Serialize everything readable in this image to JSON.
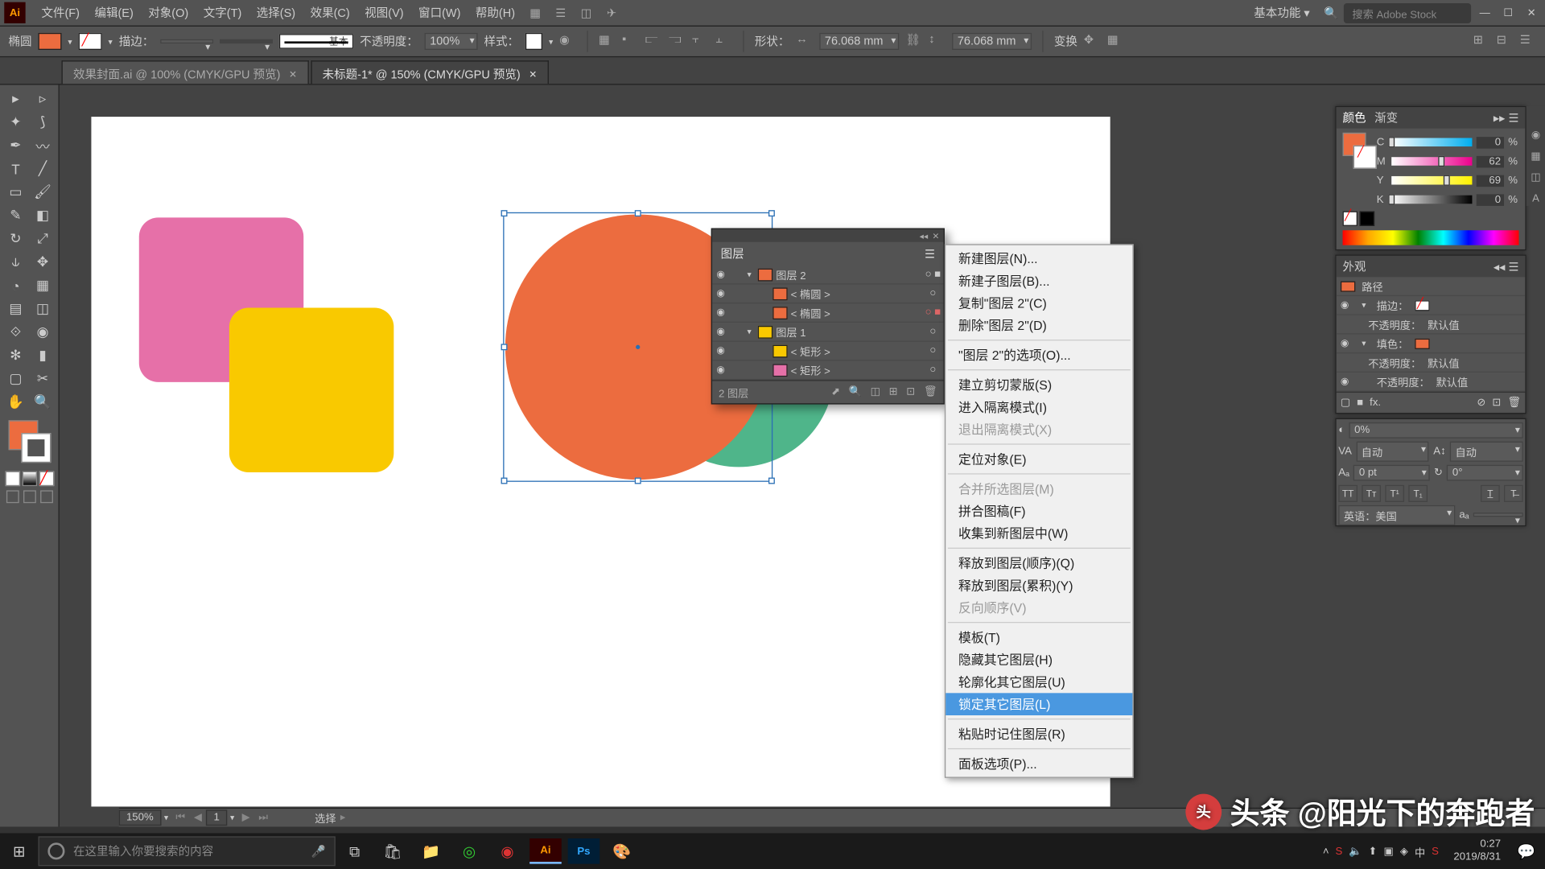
{
  "menu": {
    "items": [
      "文件(F)",
      "编辑(E)",
      "对象(O)",
      "文字(T)",
      "选择(S)",
      "效果(C)",
      "视图(V)",
      "窗口(W)",
      "帮助(H)"
    ],
    "workspace": "基本功能 ▾",
    "search_ph": "搜索 Adobe Stock"
  },
  "control": {
    "shape": "椭圆",
    "stroke_lbl": "描边：",
    "stroke_w": " ",
    "profile": "基本",
    "opacity_lbl": "不透明度：",
    "opacity": "100%",
    "style_lbl": "样式：",
    "shape_lbl": "形状：",
    "w": "76.068 mm",
    "h": "76.068 mm",
    "transform": "变换"
  },
  "tabs": [
    {
      "t": "效果封面.ai @ 100% (CMYK/GPU 预览)",
      "a": false
    },
    {
      "t": "未标题-1* @ 150% (CMYK/GPU 预览)",
      "a": true
    }
  ],
  "status": {
    "zoom": "150%",
    "page": "1",
    "tool": "选择"
  },
  "layers": {
    "title": "图层",
    "rows": [
      {
        "eye": "◉",
        "tw": "▾",
        "sw": "#ec6c3f",
        "name": "图层 2",
        "sel": "○ ■",
        "top": true
      },
      {
        "eye": "◉",
        "tw": "",
        "sw": "#ec6c3f",
        "name": "< 椭圆 >",
        "sel": "○",
        "ind": 1
      },
      {
        "eye": "◉",
        "tw": "",
        "sw": "#ec6c3f",
        "name": "< 椭圆 >",
        "sel": "○ ■",
        "ind": 1,
        "sbox": true
      },
      {
        "eye": "◉",
        "tw": "▾",
        "sw": "#f9c900",
        "name": "图层 1",
        "sel": "○",
        "top": true
      },
      {
        "eye": "◉",
        "tw": "",
        "sw": "#f9c900",
        "name": "< 矩形 >",
        "sel": "○",
        "ind": 1
      },
      {
        "eye": "◉",
        "tw": "",
        "sw": "#e670a8",
        "name": "< 矩形 >",
        "sel": "○",
        "ind": 1
      }
    ],
    "count": "2 图层"
  },
  "ctx": [
    {
      "t": "新建图层(N)..."
    },
    {
      "t": "新建子图层(B)..."
    },
    {
      "t": "复制\"图层 2\"(C)"
    },
    {
      "t": "删除\"图层 2\"(D)"
    },
    {
      "sep": true
    },
    {
      "t": "\"图层 2\"的选项(O)..."
    },
    {
      "sep": true
    },
    {
      "t": "建立剪切蒙版(S)"
    },
    {
      "t": "进入隔离模式(I)"
    },
    {
      "t": "退出隔离模式(X)",
      "dis": true
    },
    {
      "sep": true
    },
    {
      "t": "定位对象(E)"
    },
    {
      "sep": true
    },
    {
      "t": "合并所选图层(M)",
      "dis": true
    },
    {
      "t": "拼合图稿(F)"
    },
    {
      "t": "收集到新图层中(W)"
    },
    {
      "sep": true
    },
    {
      "t": "释放到图层(顺序)(Q)"
    },
    {
      "t": "释放到图层(累积)(Y)"
    },
    {
      "t": "反向顺序(V)",
      "dis": true
    },
    {
      "sep": true
    },
    {
      "t": "模板(T)"
    },
    {
      "t": "隐藏其它图层(H)"
    },
    {
      "t": "轮廓化其它图层(U)"
    },
    {
      "t": "锁定其它图层(L)",
      "hl": true
    },
    {
      "sep": true
    },
    {
      "t": "粘贴时记住图层(R)"
    },
    {
      "sep": true
    },
    {
      "t": "面板选项(P)..."
    }
  ],
  "color": {
    "tab1": "颜色",
    "tab2": "渐变",
    "c": "0",
    "m": "62",
    "y": "69",
    "k": "0"
  },
  "appear": {
    "title": "外观",
    "path": "路径",
    "rows": [
      {
        "lbl": "描边：",
        "sw": "none",
        "sub": ""
      },
      {
        "lbl": "不透明度：",
        "val": "默认值",
        "ind": true
      },
      {
        "lbl": "填色：",
        "sw": "#ec6c3f"
      },
      {
        "lbl": "不透明度：",
        "val": "默认值",
        "ind": true
      },
      {
        "lbl": "不透明度：",
        "val": "默认值"
      }
    ]
  },
  "char": {
    "opacity": "0%",
    "auto": "自动",
    "leading": "自动",
    "tracking": "0 pt",
    "rotate": "0°",
    "lang": "英语：美国",
    "aa": "aₐ"
  },
  "taskbar": {
    "search": "在这里输入你要搜索的内容",
    "ime": "中",
    "time": "0:27",
    "date": "2019/8/31"
  },
  "watermark": "头条 @阳光下的奔跑者"
}
